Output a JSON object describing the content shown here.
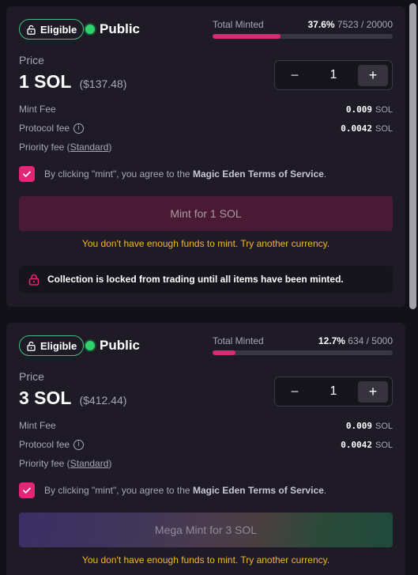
{
  "colors": {
    "accent": "#e42575",
    "eligible": "#3fbf82",
    "live_dot": "#2fd26b",
    "warning": "#f5b820"
  },
  "stages": [
    {
      "eligible_label": "Eligible",
      "stage_name": "Public",
      "total_minted_label": "Total Minted",
      "minted_percent": "37.6%",
      "minted_count": "7523 / 20000",
      "progress_fraction": 0.376,
      "price_label": "Price",
      "price": "1 SOL",
      "price_usd": "($137.48)",
      "quantity": "1",
      "mint_fee_label": "Mint Fee",
      "mint_fee_value": "0.009",
      "mint_fee_unit": "SOL",
      "protocol_fee_label": "Protocol fee",
      "protocol_fee_value": "0.0042",
      "protocol_fee_unit": "SOL",
      "priority_fee_label": "Priority fee (",
      "priority_fee_link": "Standard",
      "priority_fee_close": ")",
      "terms_prefix": "By clicking \"mint\", you agree to the ",
      "terms_link": "Magic Eden Terms of Service",
      "terms_suffix": ".",
      "mint_button_label": "Mint for 1 SOL",
      "warning": "You don't have enough funds to mint. Try another currency.",
      "locked_notice": "Collection is locked from trading until all items have been minted."
    },
    {
      "eligible_label": "Eligible",
      "stage_name": "Public",
      "total_minted_label": "Total Minted",
      "minted_percent": "12.7%",
      "minted_count": "634 / 5000",
      "progress_fraction": 0.127,
      "price_label": "Price",
      "price": "3 SOL",
      "price_usd": "($412.44)",
      "quantity": "1",
      "mint_fee_label": "Mint Fee",
      "mint_fee_value": "0.009",
      "mint_fee_unit": "SOL",
      "protocol_fee_label": "Protocol fee",
      "protocol_fee_value": "0.0042",
      "protocol_fee_unit": "SOL",
      "priority_fee_label": "Priority fee (",
      "priority_fee_link": "Standard",
      "priority_fee_close": ")",
      "terms_prefix": "By clicking \"mint\", you agree to the ",
      "terms_link": "Magic Eden Terms of Service",
      "terms_suffix": ".",
      "mint_button_label": "Mega Mint for 3 SOL",
      "warning": "You don't have enough funds to mint. Try another currency."
    }
  ]
}
